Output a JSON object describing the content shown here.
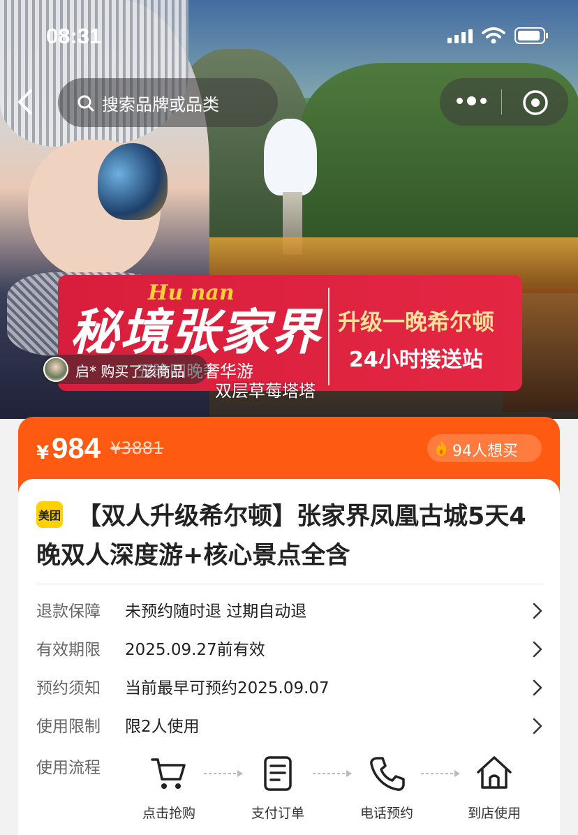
{
  "status_bar": {
    "time": "08:31"
  },
  "top_bar": {
    "search_placeholder": "搜索品牌或品类"
  },
  "banner": {
    "script_text": "Hu nan",
    "main_text": "秘境张家界",
    "sub_text": "五晚四晚奢华游",
    "right_line1": "升级一晚希尔顿",
    "right_line2": "24小时接送站"
  },
  "buyer_ticker": {
    "text": "启* 购买了该商品"
  },
  "shop_name": "双层草莓塔塔",
  "price": {
    "currency": "¥",
    "current": "984",
    "original": "¥3881",
    "want_count_text": "94人想买"
  },
  "product": {
    "badge": "美团",
    "title": "【双人升级希尔顿】张家界凤凰古城5天4晚双人深度游+核心景点全含"
  },
  "info_rows": [
    {
      "label": "退款保障",
      "value": "未预约随时退 过期自动退"
    },
    {
      "label": "有效期限",
      "value": "2025.09.27前有效"
    },
    {
      "label": "预约须知",
      "value": "当前最早可预约2025.09.07"
    },
    {
      "label": "使用限制",
      "value": "限2人使用"
    }
  ],
  "usage_flow": {
    "label": "使用流程",
    "steps": [
      {
        "icon": "cart-icon",
        "text": "点击抢购"
      },
      {
        "icon": "receipt-icon",
        "text": "支付订单"
      },
      {
        "icon": "phone-icon",
        "text": "电话预约"
      },
      {
        "icon": "store-icon",
        "text": "到店使用"
      }
    ]
  },
  "colors": {
    "accent": "#ff5a12",
    "banner_red": "#d81e3c",
    "meituan_yellow": "#ffd100"
  }
}
